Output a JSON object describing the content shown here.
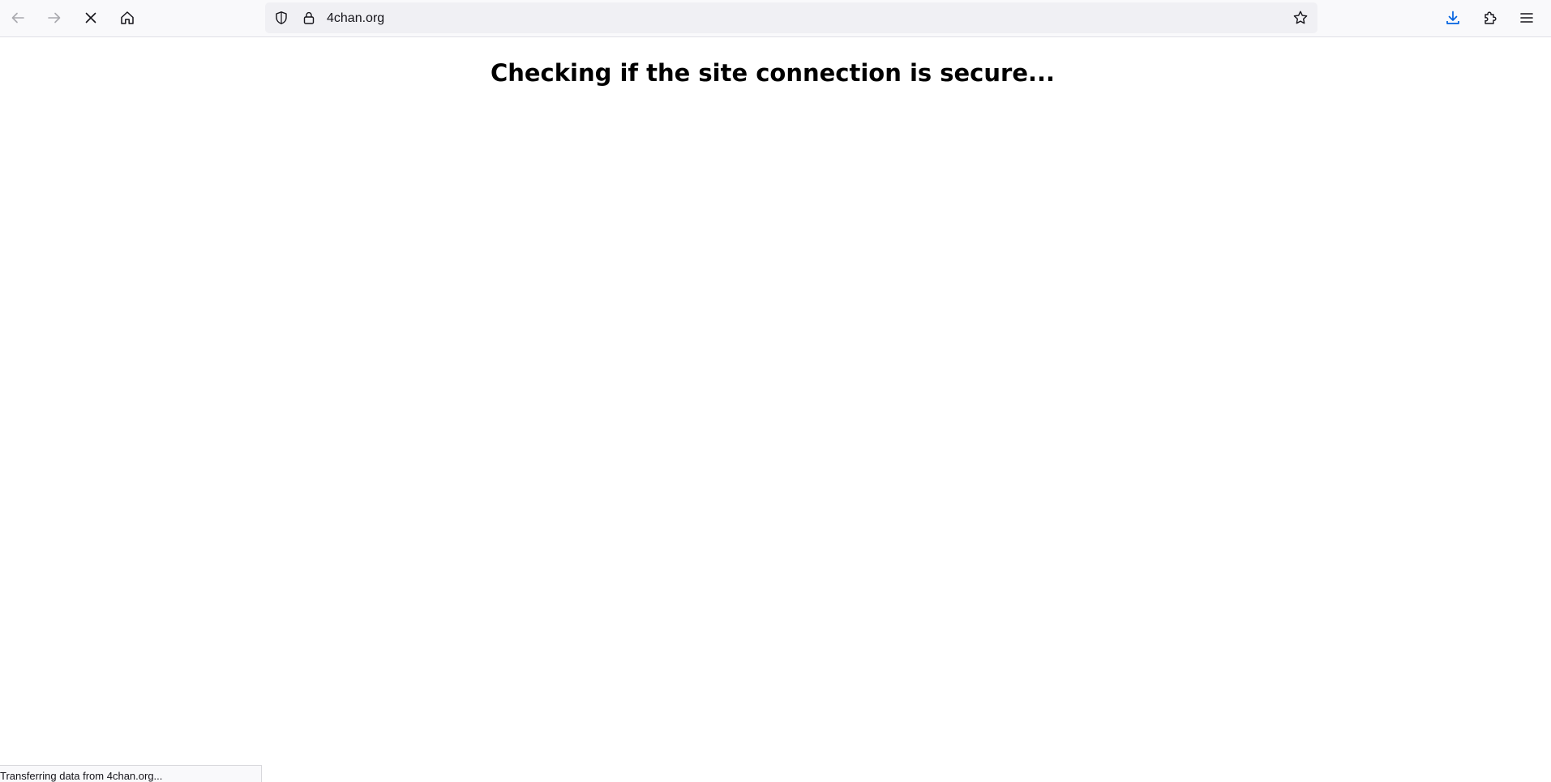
{
  "browser": {
    "nav": {
      "back_icon": "arrow-left-icon",
      "forward_icon": "arrow-right-icon",
      "stop_icon": "close-x-icon",
      "home_icon": "home-icon"
    },
    "urlbar": {
      "tracking_icon": "shield-icon",
      "security_icon": "lock-icon",
      "url": "4chan.org",
      "bookmark_icon": "star-icon"
    },
    "toolbar_right": {
      "downloads_icon": "download-arrow-icon",
      "extensions_icon": "puzzle-piece-icon",
      "menu_icon": "hamburger-menu-icon"
    },
    "status": "Transferring data from 4chan.org..."
  },
  "page": {
    "heading": "Checking if the site connection is secure..."
  },
  "colors": {
    "toolbar_bg": "#f9f9fb",
    "urlbar_bg": "#f0f0f4",
    "icon_default": "#15141a",
    "icon_disabled": "#a9a9ae",
    "download_accent": "#0061e0"
  }
}
